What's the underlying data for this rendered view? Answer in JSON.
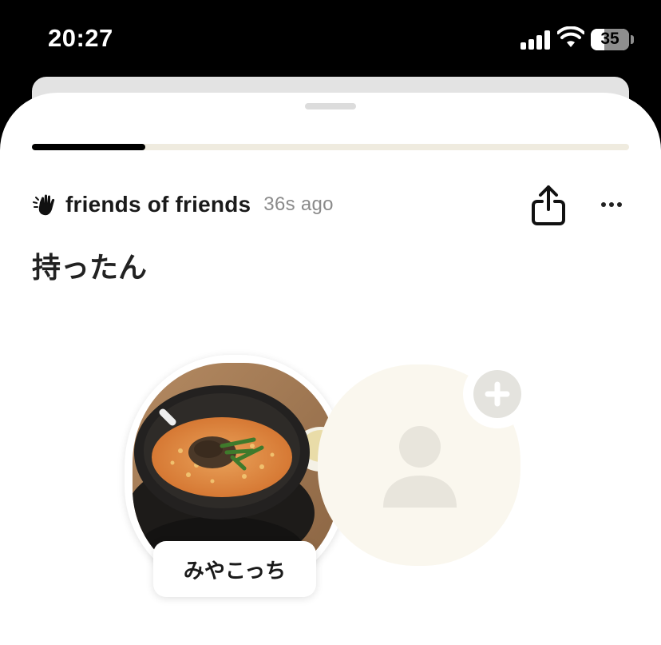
{
  "status_bar": {
    "time": "20:27",
    "battery_level": "35",
    "icons": [
      "signal-icon",
      "wifi-icon",
      "battery-icon"
    ]
  },
  "sheet": {
    "progress": 0.19,
    "audience_label": "friends of friends",
    "time_ago": "36s ago",
    "title": "持ったん",
    "icons": {
      "audience": "wave-hand-icon",
      "share": "share-icon",
      "more": "more-icon"
    }
  },
  "participants": [
    {
      "name": "みやこっち",
      "has_photo": true
    },
    {
      "name": "",
      "has_photo": false,
      "add_icon": "plus-icon"
    }
  ],
  "colors": {
    "progress_fill": "#000000",
    "progress_track": "#efebdf",
    "empty_avatar": "#faf7ee",
    "muted_text": "#8a8a8a"
  }
}
